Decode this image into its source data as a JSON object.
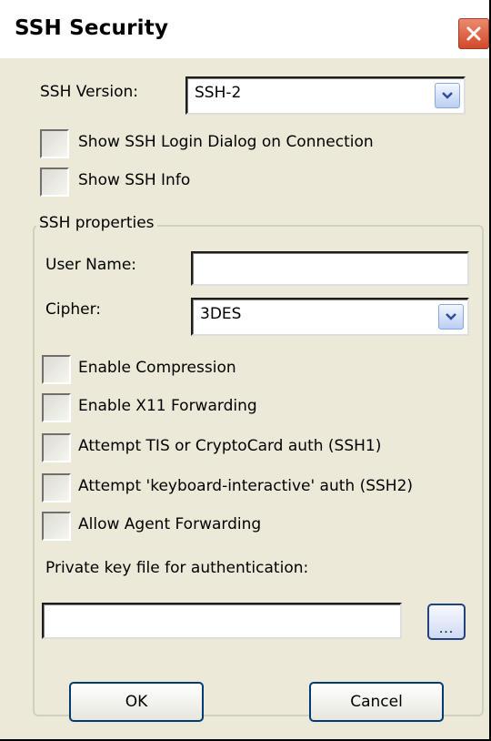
{
  "window": {
    "title": "SSH Security"
  },
  "ssh_version": {
    "label": "SSH Version:",
    "value": "SSH-2"
  },
  "options": {
    "show_login_dialog_label": "Show SSH Login Dialog on Connection",
    "show_login_dialog_checked": false,
    "show_info_label": "Show SSH Info",
    "show_info_checked": false
  },
  "properties": {
    "group_title": "SSH properties",
    "user_name_label": "User Name:",
    "user_name_value": "",
    "cipher_label": "Cipher:",
    "cipher_value": "3DES",
    "checkboxes": [
      {
        "label": "Enable Compression",
        "checked": false
      },
      {
        "label": "Enable X11 Forwarding",
        "checked": false
      },
      {
        "label": "Attempt TIS or CryptoCard auth (SSH1)",
        "checked": false
      },
      {
        "label": "Attempt 'keyboard-interactive' auth (SSH2)",
        "checked": false
      },
      {
        "label": "Allow Agent Forwarding",
        "checked": false
      }
    ],
    "private_key_label": "Private key file for authentication:",
    "private_key_value": "",
    "browse_label": "..."
  },
  "buttons": {
    "ok": "OK",
    "cancel": "Cancel"
  },
  "colors": {
    "dialog_background": "#ece9d8",
    "close_button": "#d2492a",
    "button_border": "#003c74"
  },
  "icons": {
    "close": "close-icon",
    "dropdown": "chevron-down-icon"
  }
}
